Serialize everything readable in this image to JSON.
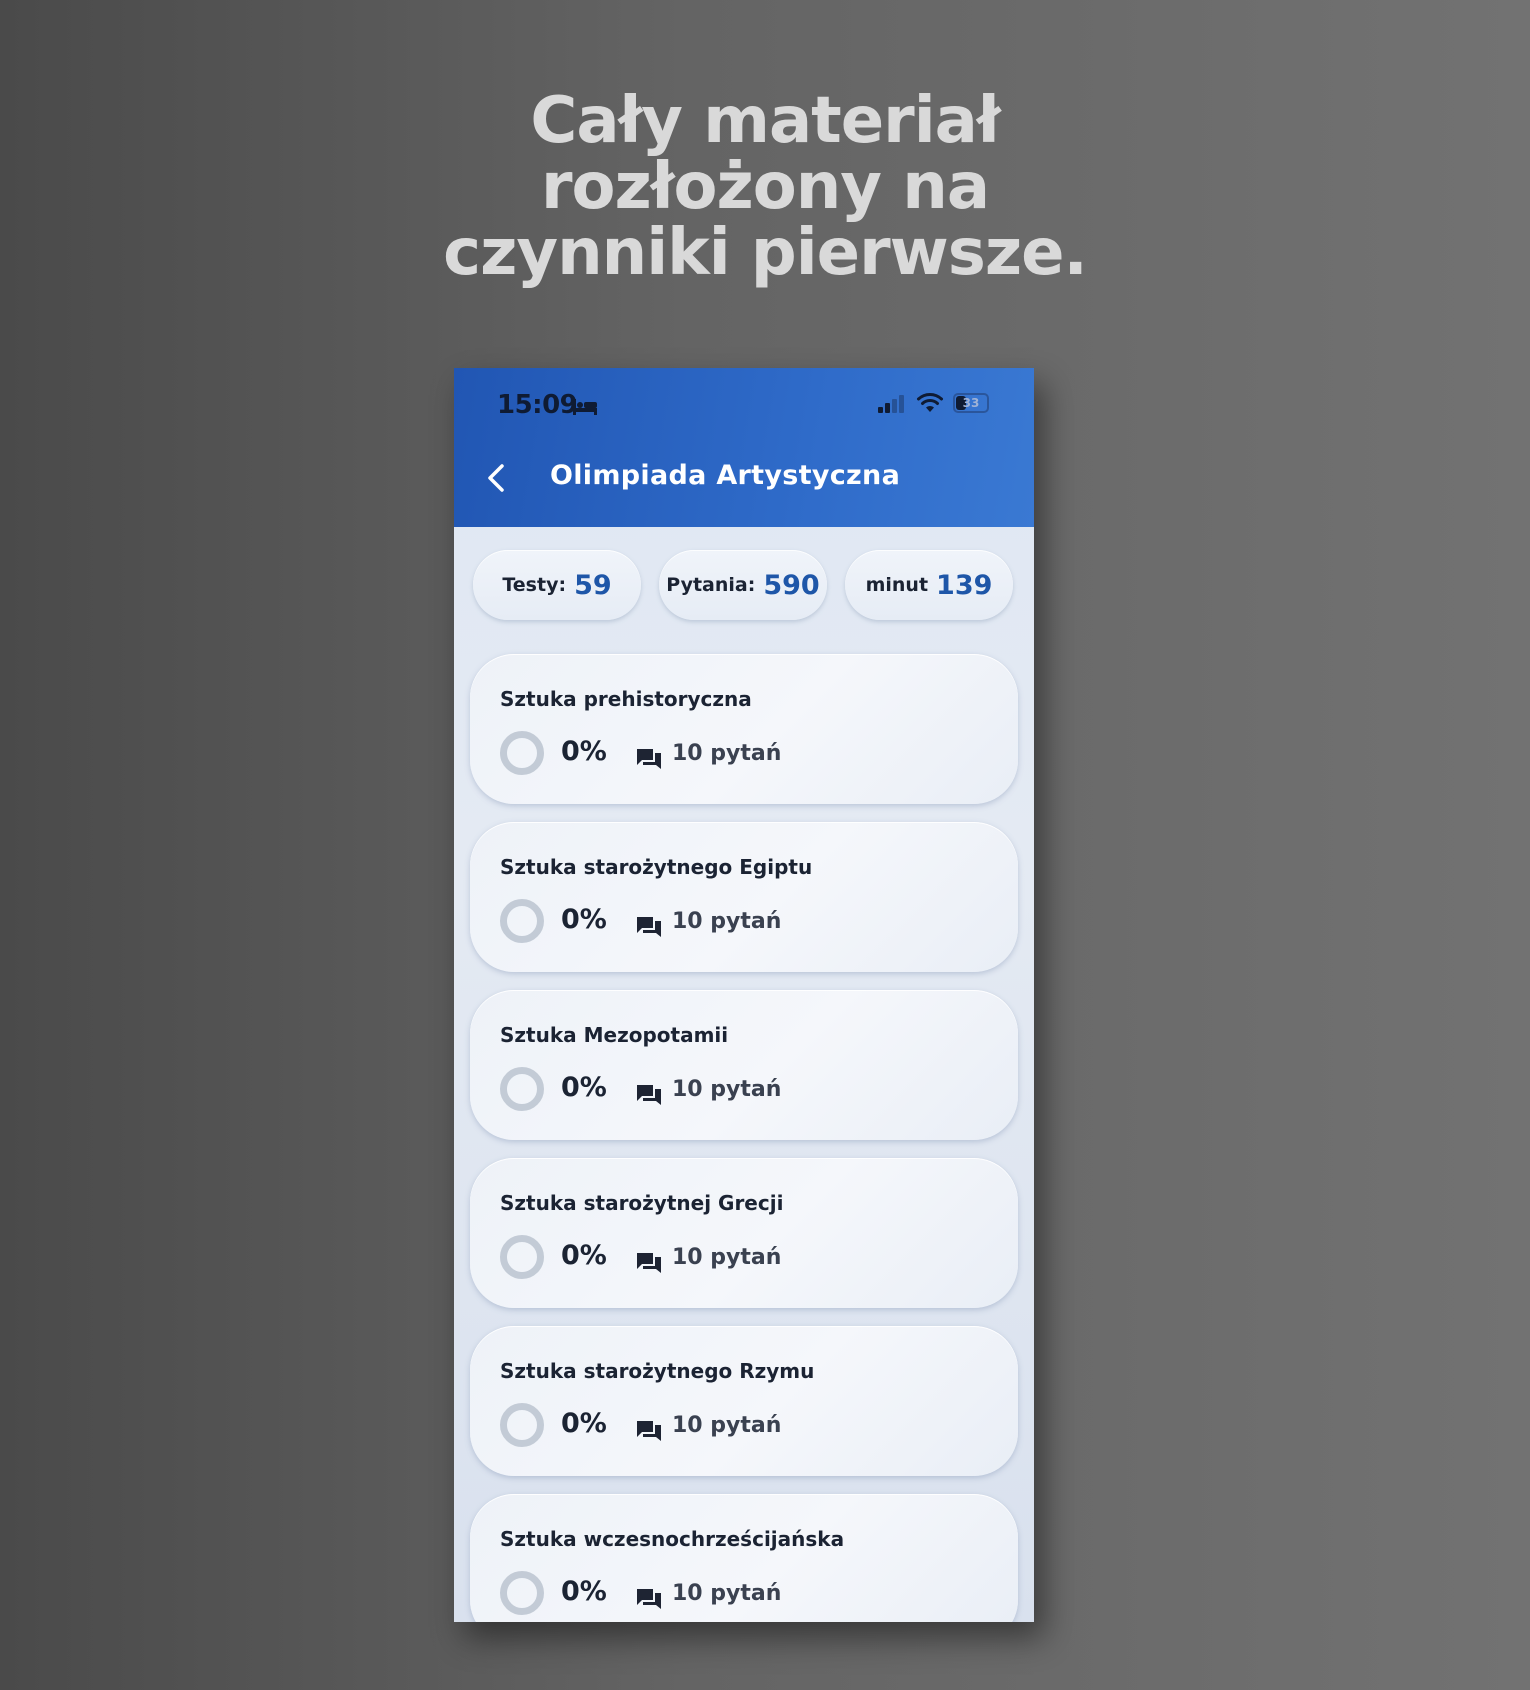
{
  "headline": {
    "line1": "Cały materiał",
    "line2": "rozłożony na",
    "line3": "czynniki pierwsze."
  },
  "status_bar": {
    "time": "15:09",
    "battery_text": "33",
    "battery_level": 0.33
  },
  "header": {
    "title": "Olimpiada Artystyczna",
    "back_icon": "chevron-left-icon"
  },
  "stats": [
    {
      "label": "Testy:",
      "value": "59"
    },
    {
      "label": "Pytania:",
      "value": "590"
    },
    {
      "label": "minut",
      "value": "139"
    }
  ],
  "topics": [
    {
      "title": "Sztuka prehistoryczna",
      "progress": "0%",
      "questions": "10 pytań"
    },
    {
      "title": "Sztuka starożytnego Egiptu",
      "progress": "0%",
      "questions": "10 pytań"
    },
    {
      "title": "Sztuka Mezopotamii",
      "progress": "0%",
      "questions": "10 pytań"
    },
    {
      "title": "Sztuka starożytnej Grecji",
      "progress": "0%",
      "questions": "10 pytań"
    },
    {
      "title": "Sztuka starożytnego Rzymu",
      "progress": "0%",
      "questions": "10 pytań"
    },
    {
      "title": "Sztuka wczesnochrześcijańska",
      "progress": "0%",
      "questions": "10 pytań"
    }
  ],
  "colors": {
    "header_blue": "#2156b3",
    "stat_value_blue": "#1e56a8",
    "background_gray": "#646464"
  }
}
